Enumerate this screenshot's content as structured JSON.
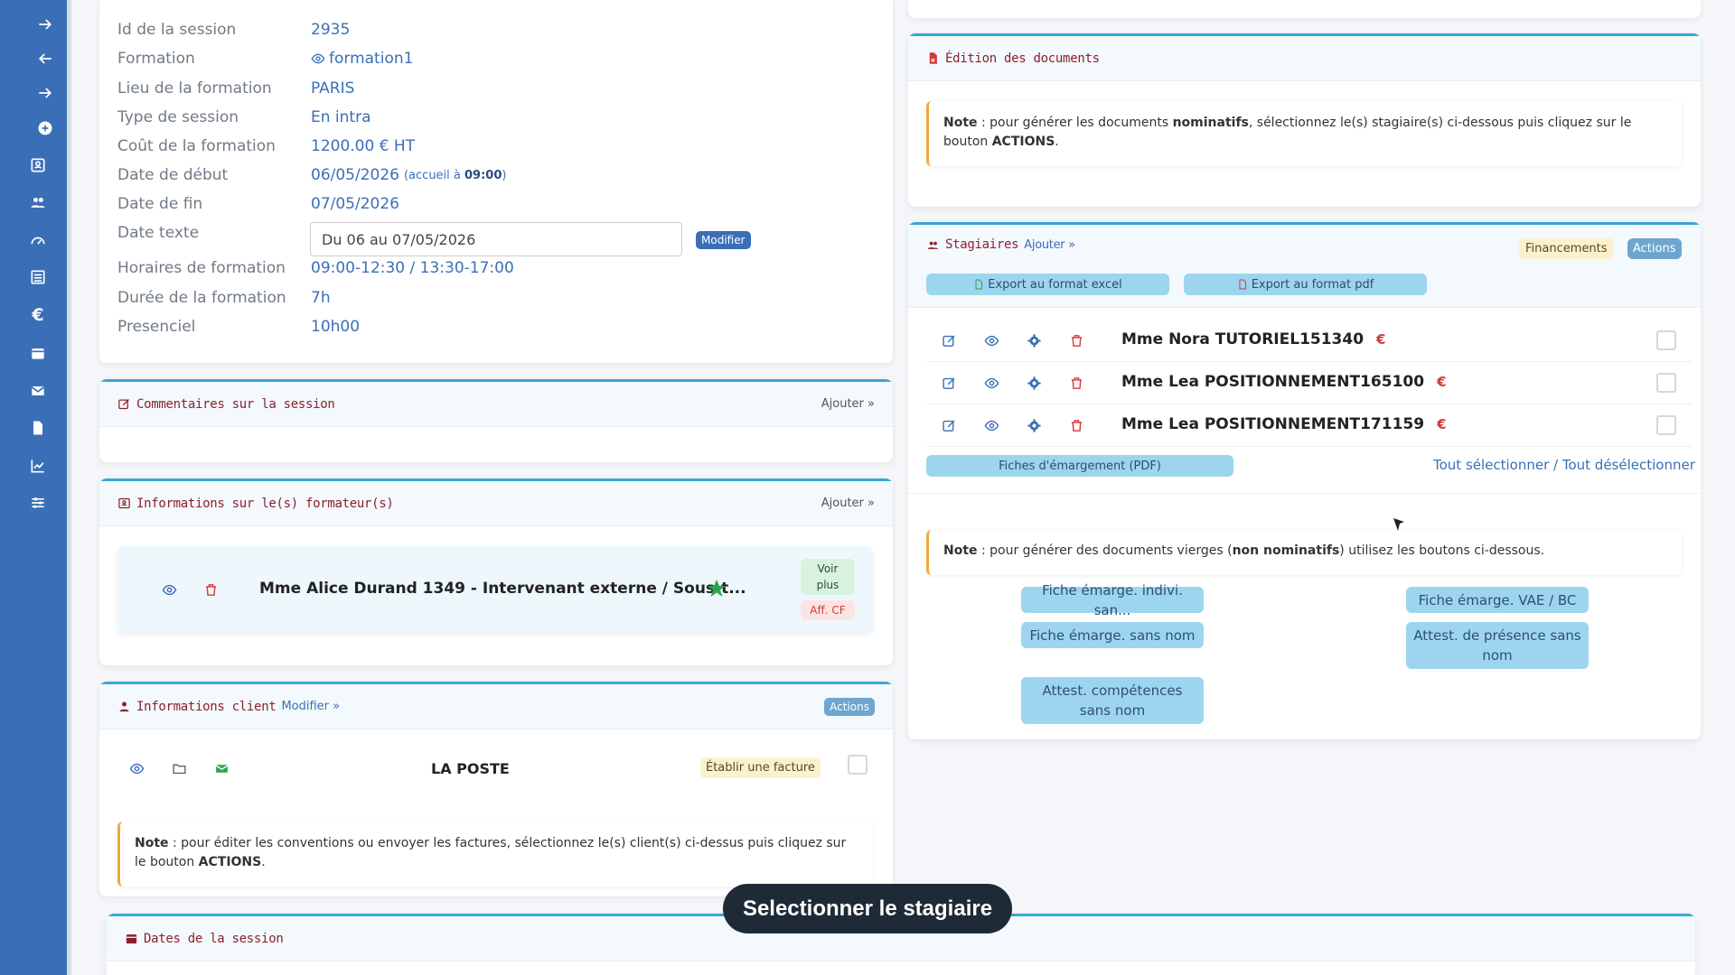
{
  "session": {
    "rows": [
      {
        "label": "Id de la session",
        "value": "2935"
      },
      {
        "label": "Formation",
        "value": "formation1"
      },
      {
        "label": "Lieu de la formation",
        "value": "PARIS"
      },
      {
        "label": "Type de session",
        "value": "En intra"
      },
      {
        "label": "Coût de la formation",
        "value": "1200.00 € HT"
      },
      {
        "label": "Date de début",
        "value": "06/05/2026",
        "extra_prefix": "(accueil à ",
        "extra_time": "09:00",
        "extra_suffix": ")"
      },
      {
        "label": "Date de fin",
        "value": "07/05/2026"
      },
      {
        "label": "Date texte",
        "value": ""
      },
      {
        "label": "Horaires de formation",
        "value": "09:00-12:30 / 13:30-17:00"
      },
      {
        "label": "Durée de la formation",
        "value": "7h"
      },
      {
        "label": "Presenciel",
        "value": "10h00"
      }
    ],
    "date_texte_value": "Du 06 au 07/05/2026",
    "modifier_label": "Modifier"
  },
  "comments": {
    "title": "Commentaires sur la session",
    "add_label": "Ajouter »"
  },
  "formateurs": {
    "title": "Informations sur le(s) formateur(s)",
    "add_label": "Ajouter »",
    "item": {
      "name": "Mme Alice Durand 1349 - Intervenant externe / Sous-t...",
      "voir_plus_1": "Voir",
      "voir_plus_2": "plus",
      "aff_cf": "Aff. CF"
    }
  },
  "client": {
    "title": "Informations client",
    "modify_label": "Modifier »",
    "actions_label": "Actions",
    "name": "LA POSTE",
    "invoice_label": "Établir une facture",
    "note_bold": "Note",
    "note_text": " : pour éditer les conventions ou envoyer les factures, sélectionnez le(s) client(s) ci-dessus puis cliquez sur le bouton ",
    "note_action": "ACTIONS",
    "note_end": "."
  },
  "dates": {
    "title": "Dates de la session"
  },
  "documents": {
    "title": "Édition des documents",
    "note_bold": "Note",
    "note_text_1": " : pour générer les documents ",
    "note_bold_2": "nominatifs",
    "note_text_2": ", sélectionnez le(s) stagiaire(s) ci-dessous puis cliquez sur le bouton ",
    "note_action": "ACTIONS",
    "note_end": "."
  },
  "stagiaires": {
    "title": "Stagiaires",
    "add_label": "Ajouter »",
    "financements_label": "Financements",
    "actions_label": "Actions",
    "export_excel": "Export au format excel",
    "export_pdf": "Export au format pdf",
    "list": [
      {
        "name": "Mme Nora TUTORIEL151340",
        "euro": "€"
      },
      {
        "name": "Mme Lea POSITIONNEMENT165100",
        "euro": "€"
      },
      {
        "name": "Mme Lea POSITIONNEMENT171159",
        "euro": "€"
      }
    ],
    "fiches_pdf": "Fiches d'émargement (PDF)",
    "select_all": "Tout sélectionner / Tout désélectionner",
    "note_bold": "Note",
    "note_text_1": " : pour générer des documents vierges (",
    "note_bold_2": "non nominatifs",
    "note_text_2": ") utilisez les boutons ci-dessous.",
    "doc_buttons": [
      "Fiche émarge. indivi. san...",
      "Fiche émarge. VAE / BC",
      "Fiche émarge. sans nom",
      "Attest. de présence sans nom",
      "Attest. compétences sans nom"
    ]
  },
  "tooltip": "Selectionner le stagiaire",
  "colors": {
    "sidebar": "#3a6fb7",
    "accent": "#3aa6d6",
    "title_red": "#8d1f2c",
    "danger": "#d23a3a",
    "success": "#2fa34b"
  }
}
